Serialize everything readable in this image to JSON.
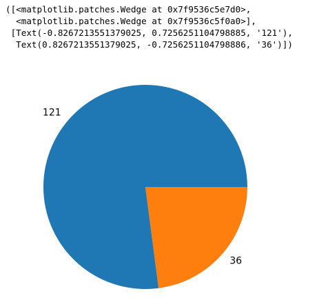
{
  "output": {
    "lines": [
      "([<matplotlib.patches.Wedge at 0x7f9536c5e7d0>,",
      "  <matplotlib.patches.Wedge at 0x7f9536c5f0a0>],",
      " [Text(-0.8267213551379025, 0.7256251104798885, '121'),",
      "  Text(0.8267213551379025, -0.7256251104798886, '36')])"
    ]
  },
  "chart_data": {
    "type": "pie",
    "values": [
      121,
      36
    ],
    "labels": [
      "121",
      "36"
    ],
    "colors": [
      "#1f77b4",
      "#ff7f0e"
    ],
    "start_angle_deg": 0,
    "direction": "counterclockwise"
  }
}
